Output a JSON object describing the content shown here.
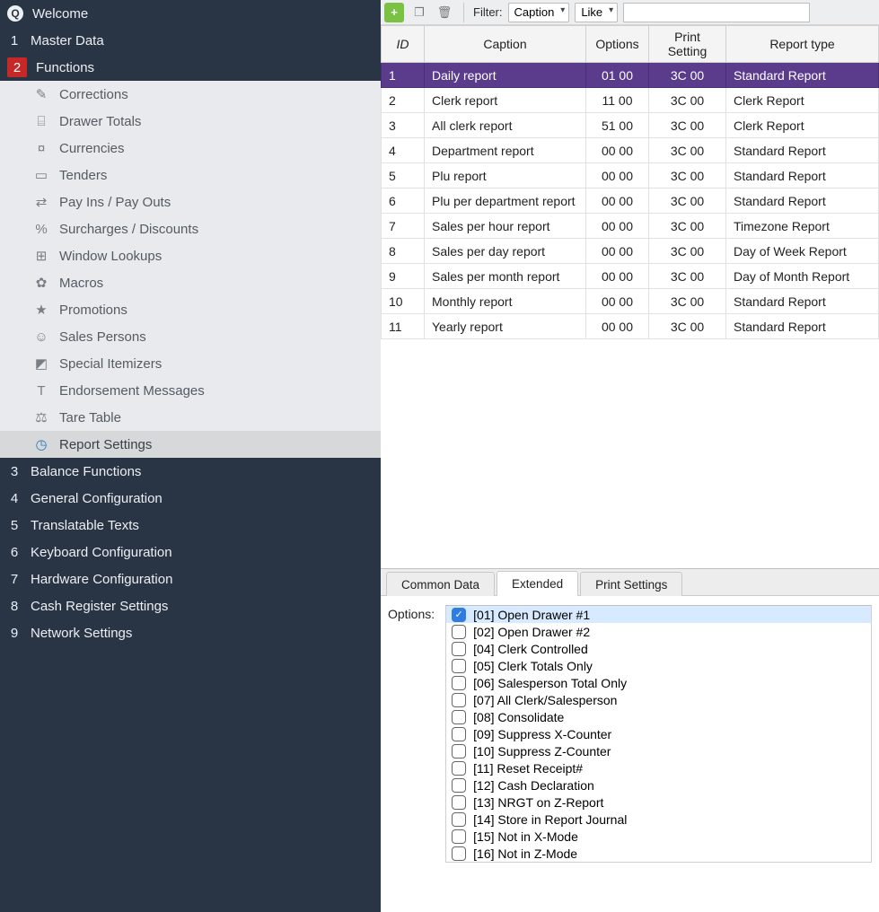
{
  "sidebar": {
    "welcome": "Welcome",
    "top": [
      {
        "num": "1",
        "label": "Master Data"
      },
      {
        "num": "2",
        "label": "Functions"
      }
    ],
    "sub": [
      {
        "label": "Corrections"
      },
      {
        "label": "Drawer Totals"
      },
      {
        "label": "Currencies"
      },
      {
        "label": "Tenders"
      },
      {
        "label": "Pay Ins / Pay Outs"
      },
      {
        "label": "Surcharges / Discounts"
      },
      {
        "label": "Window Lookups"
      },
      {
        "label": "Macros"
      },
      {
        "label": "Promotions"
      },
      {
        "label": "Sales Persons"
      },
      {
        "label": "Special Itemizers"
      },
      {
        "label": "Endorsement Messages"
      },
      {
        "label": "Tare Table"
      },
      {
        "label": "Report Settings"
      }
    ],
    "bottom": [
      {
        "num": "3",
        "label": "Balance Functions"
      },
      {
        "num": "4",
        "label": "General Configuration"
      },
      {
        "num": "5",
        "label": "Translatable Texts"
      },
      {
        "num": "6",
        "label": "Keyboard Configuration"
      },
      {
        "num": "7",
        "label": "Hardware Configuration"
      },
      {
        "num": "8",
        "label": "Cash Register Settings"
      },
      {
        "num": "9",
        "label": "Network Settings"
      }
    ]
  },
  "toolbar": {
    "filter_label": "Filter:",
    "filter_field": "Caption",
    "filter_op": "Like",
    "filter_value": ""
  },
  "table": {
    "headers": {
      "id": "ID",
      "caption": "Caption",
      "options": "Options",
      "print": "Print Setting",
      "type": "Report type"
    },
    "rows": [
      {
        "id": "1",
        "caption": "Daily report",
        "options": "01 00",
        "print": "3C 00",
        "type": "Standard Report"
      },
      {
        "id": "2",
        "caption": "Clerk report",
        "options": "11 00",
        "print": "3C 00",
        "type": "Clerk Report"
      },
      {
        "id": "3",
        "caption": "All clerk report",
        "options": "51 00",
        "print": "3C 00",
        "type": "Clerk Report"
      },
      {
        "id": "4",
        "caption": "Department report",
        "options": "00 00",
        "print": "3C 00",
        "type": "Standard Report"
      },
      {
        "id": "5",
        "caption": "Plu report",
        "options": "00 00",
        "print": "3C 00",
        "type": "Standard Report"
      },
      {
        "id": "6",
        "caption": "Plu per department report",
        "options": "00 00",
        "print": "3C 00",
        "type": "Standard Report"
      },
      {
        "id": "7",
        "caption": "Sales per hour report",
        "options": "00 00",
        "print": "3C 00",
        "type": "Timezone Report"
      },
      {
        "id": "8",
        "caption": "Sales per day report",
        "options": "00 00",
        "print": "3C 00",
        "type": "Day of Week Report"
      },
      {
        "id": "9",
        "caption": "Sales per month report",
        "options": "00 00",
        "print": "3C 00",
        "type": "Day of Month Report"
      },
      {
        "id": "10",
        "caption": "Monthly report",
        "options": "00 00",
        "print": "3C 00",
        "type": "Standard Report"
      },
      {
        "id": "11",
        "caption": "Yearly report",
        "options": "00 00",
        "print": "3C 00",
        "type": "Standard Report"
      }
    ]
  },
  "tabs": {
    "common": "Common Data",
    "extended": "Extended",
    "print": "Print Settings"
  },
  "detail": {
    "options_label": "Options:",
    "items": [
      {
        "code": "[01]",
        "label": "Open Drawer #1",
        "checked": true
      },
      {
        "code": "[02]",
        "label": "Open Drawer #2",
        "checked": false
      },
      {
        "code": "[04]",
        "label": "Clerk Controlled",
        "checked": false
      },
      {
        "code": "[05]",
        "label": "Clerk Totals Only",
        "checked": false
      },
      {
        "code": "[06]",
        "label": "Salesperson Total Only",
        "checked": false
      },
      {
        "code": "[07]",
        "label": "All Clerk/Salesperson",
        "checked": false
      },
      {
        "code": "[08]",
        "label": "Consolidate",
        "checked": false
      },
      {
        "code": "[09]",
        "label": "Suppress X-Counter",
        "checked": false
      },
      {
        "code": "[10]",
        "label": "Suppress Z-Counter",
        "checked": false
      },
      {
        "code": "[11]",
        "label": "Reset Receipt#",
        "checked": false
      },
      {
        "code": "[12]",
        "label": "Cash Declaration",
        "checked": false
      },
      {
        "code": "[13]",
        "label": "NRGT on Z-Report",
        "checked": false
      },
      {
        "code": "[14]",
        "label": "Store in Report Journal",
        "checked": false
      },
      {
        "code": "[15]",
        "label": "Not in X-Mode",
        "checked": false
      },
      {
        "code": "[16]",
        "label": "Not in Z-Mode",
        "checked": false
      }
    ]
  }
}
